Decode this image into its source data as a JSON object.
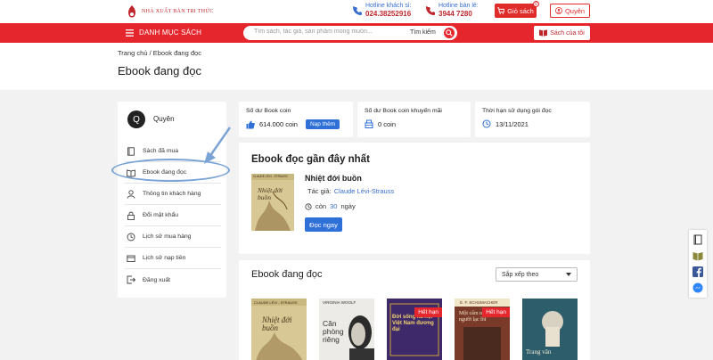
{
  "header": {
    "logo_text": "NHÀ XUẤT BẢN TRI THỨC",
    "hotline_customer_label": "Hotline khách sỉ:",
    "hotline_customer_number": "024.38252916",
    "hotline_retail_label": "Hotline bán lẻ:",
    "hotline_retail_number": "3944 7280",
    "cart_label": "Giỏ sách",
    "cart_count": "0",
    "user_label": "Quyên"
  },
  "nav": {
    "menu_label": "DANH MỤC SÁCH",
    "search_placeholder": "Tìm sách, tác giả, sản phẩm mong muốn...",
    "search_button": "Tìm kiếm",
    "shelf_label": "Sách của tôi"
  },
  "breadcrumb": "Trang chủ / Ebook đang đọc",
  "page_title": "Ebook đang đọc",
  "sidebar": {
    "avatar_letter": "Q",
    "username": "Quyên",
    "items": [
      {
        "label": "Sách đã mua",
        "icon": "book-icon"
      },
      {
        "label": "Ebook đang đọc",
        "icon": "open-book-icon"
      },
      {
        "label": "Thông tin khách hàng",
        "icon": "user-icon"
      },
      {
        "label": "Đổi mật khẩu",
        "icon": "lock-icon"
      },
      {
        "label": "Lịch sử mua hàng",
        "icon": "history-icon"
      },
      {
        "label": "Lịch sử nạp tiền",
        "icon": "wallet-icon"
      },
      {
        "label": "Đăng xuất",
        "icon": "logout-icon"
      }
    ]
  },
  "stats": [
    {
      "label": "Số dư Book coin",
      "value": "614.000 coin",
      "button": "Nạp thêm"
    },
    {
      "label": "Số dư Book coin khuyến mãi",
      "value": "0 coin"
    },
    {
      "label": "Thời hạn sử dụng gói đọc",
      "value": "13/11/2021"
    }
  ],
  "recent": {
    "heading": "Ebook đọc gần đây nhất",
    "cover_author": "CLAUDE LÉVI - STRAUSS",
    "cover_title": "Nhiệt đới buồn",
    "title": "Nhiệt đới buồn",
    "author_label": "Tác giả:",
    "author": "Claude Lévi-Strauss",
    "remaining_prefix": "còn",
    "remaining_days": "30",
    "remaining_suffix": "ngày",
    "read_button": "Đọc ngay"
  },
  "reading": {
    "heading": "Ebook đang đọc",
    "sort_label": "Sắp xếp theo",
    "covers": [
      {
        "top": "CLAUDE LÉVI - STRAUSS",
        "title": "Nhiệt đới buồn",
        "expired": ""
      },
      {
        "top": "VIRGINIA WOOLF",
        "title": "Căn phòng riêng",
        "expired": ""
      },
      {
        "top": "",
        "title": "Đời sống xã hội Việt Nam đương đại",
        "expired": "Hết hạn"
      },
      {
        "top": "E. F. SCHUMACHER",
        "title": "Một cẩm nang cho người lạc lối",
        "expired": "Hết hạn"
      },
      {
        "top": "",
        "title": "Trang văn",
        "expired": ""
      }
    ]
  },
  "colors": {
    "brand_red": "#e6262d",
    "accent_blue": "#2e6fd8",
    "link_blue": "#3a6fd0"
  }
}
